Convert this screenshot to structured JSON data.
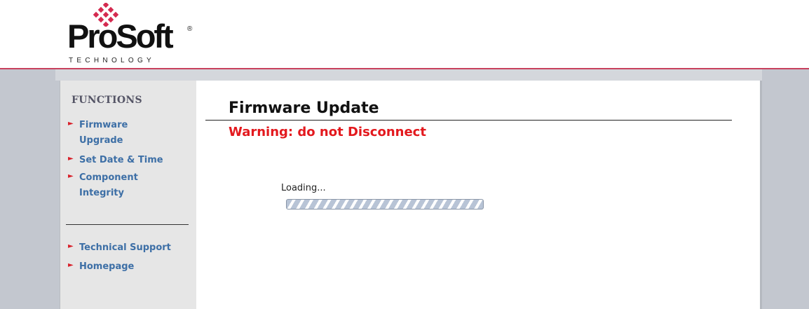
{
  "header": {
    "logo_text": "ProSoft",
    "logo_registered": "®",
    "logo_subtitle": "TECHNOLOGY"
  },
  "sidebar": {
    "title": "FUNCTIONS",
    "items": [
      {
        "label_line1": "Firmware",
        "label_line2": "Upgrade"
      },
      {
        "label_line1": "Set Date & Time"
      },
      {
        "label_line1": "Component",
        "label_line2": "Integrity"
      }
    ],
    "secondary_items": [
      {
        "label": "Technical Support"
      },
      {
        "label": "Homepage"
      }
    ],
    "bullet_glyph": "►"
  },
  "main": {
    "title": "Firmware Update",
    "warning": "Warning: do not Disconnect",
    "loading_label": "Loading...",
    "progress": "indeterminate"
  },
  "colors": {
    "brand_red": "#c8415e",
    "warning_red": "#e3191e",
    "link_blue": "#3d6fa6",
    "frame_gray": "#c3c7cf",
    "sidebar_gray": "#e6e6e6"
  }
}
